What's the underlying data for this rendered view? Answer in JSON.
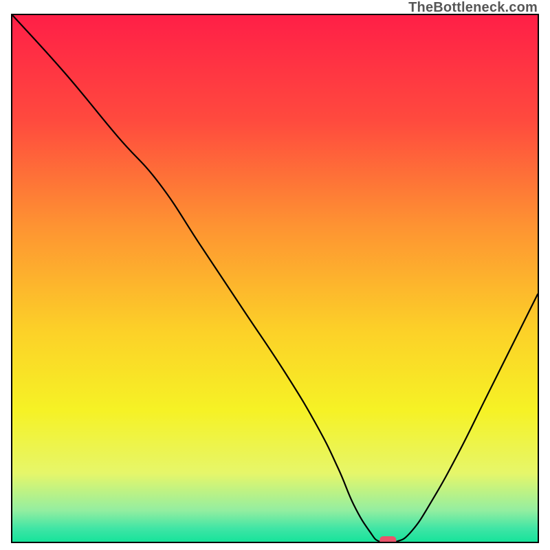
{
  "watermark": "TheBottleneck.com",
  "chart_data": {
    "type": "line",
    "title": "",
    "xlabel": "",
    "ylabel": "",
    "xlim": [
      0,
      100
    ],
    "ylim": [
      0,
      100
    ],
    "series": [
      {
        "name": "bottleneck-curve",
        "x": [
          0,
          10,
          20,
          28,
          36,
          44,
          52,
          58,
          62,
          65,
          68,
          70,
          73,
          76,
          80,
          85,
          90,
          95,
          100
        ],
        "values": [
          100,
          89,
          77,
          68,
          56,
          44,
          32,
          22,
          14,
          7,
          2,
          0,
          0,
          2,
          8,
          17,
          27,
          37,
          47
        ]
      }
    ],
    "marker": {
      "x": 71.5,
      "y": 0,
      "color": "#e9546b"
    },
    "gradient_stops": [
      {
        "offset": 0.0,
        "color": "#ff1f47"
      },
      {
        "offset": 0.2,
        "color": "#ff4a3e"
      },
      {
        "offset": 0.4,
        "color": "#fe9332"
      },
      {
        "offset": 0.6,
        "color": "#fcd128"
      },
      {
        "offset": 0.75,
        "color": "#f6f225"
      },
      {
        "offset": 0.87,
        "color": "#e6f66a"
      },
      {
        "offset": 0.94,
        "color": "#94eea0"
      },
      {
        "offset": 0.975,
        "color": "#3fe5a5"
      },
      {
        "offset": 1.0,
        "color": "#17e39b"
      }
    ]
  }
}
